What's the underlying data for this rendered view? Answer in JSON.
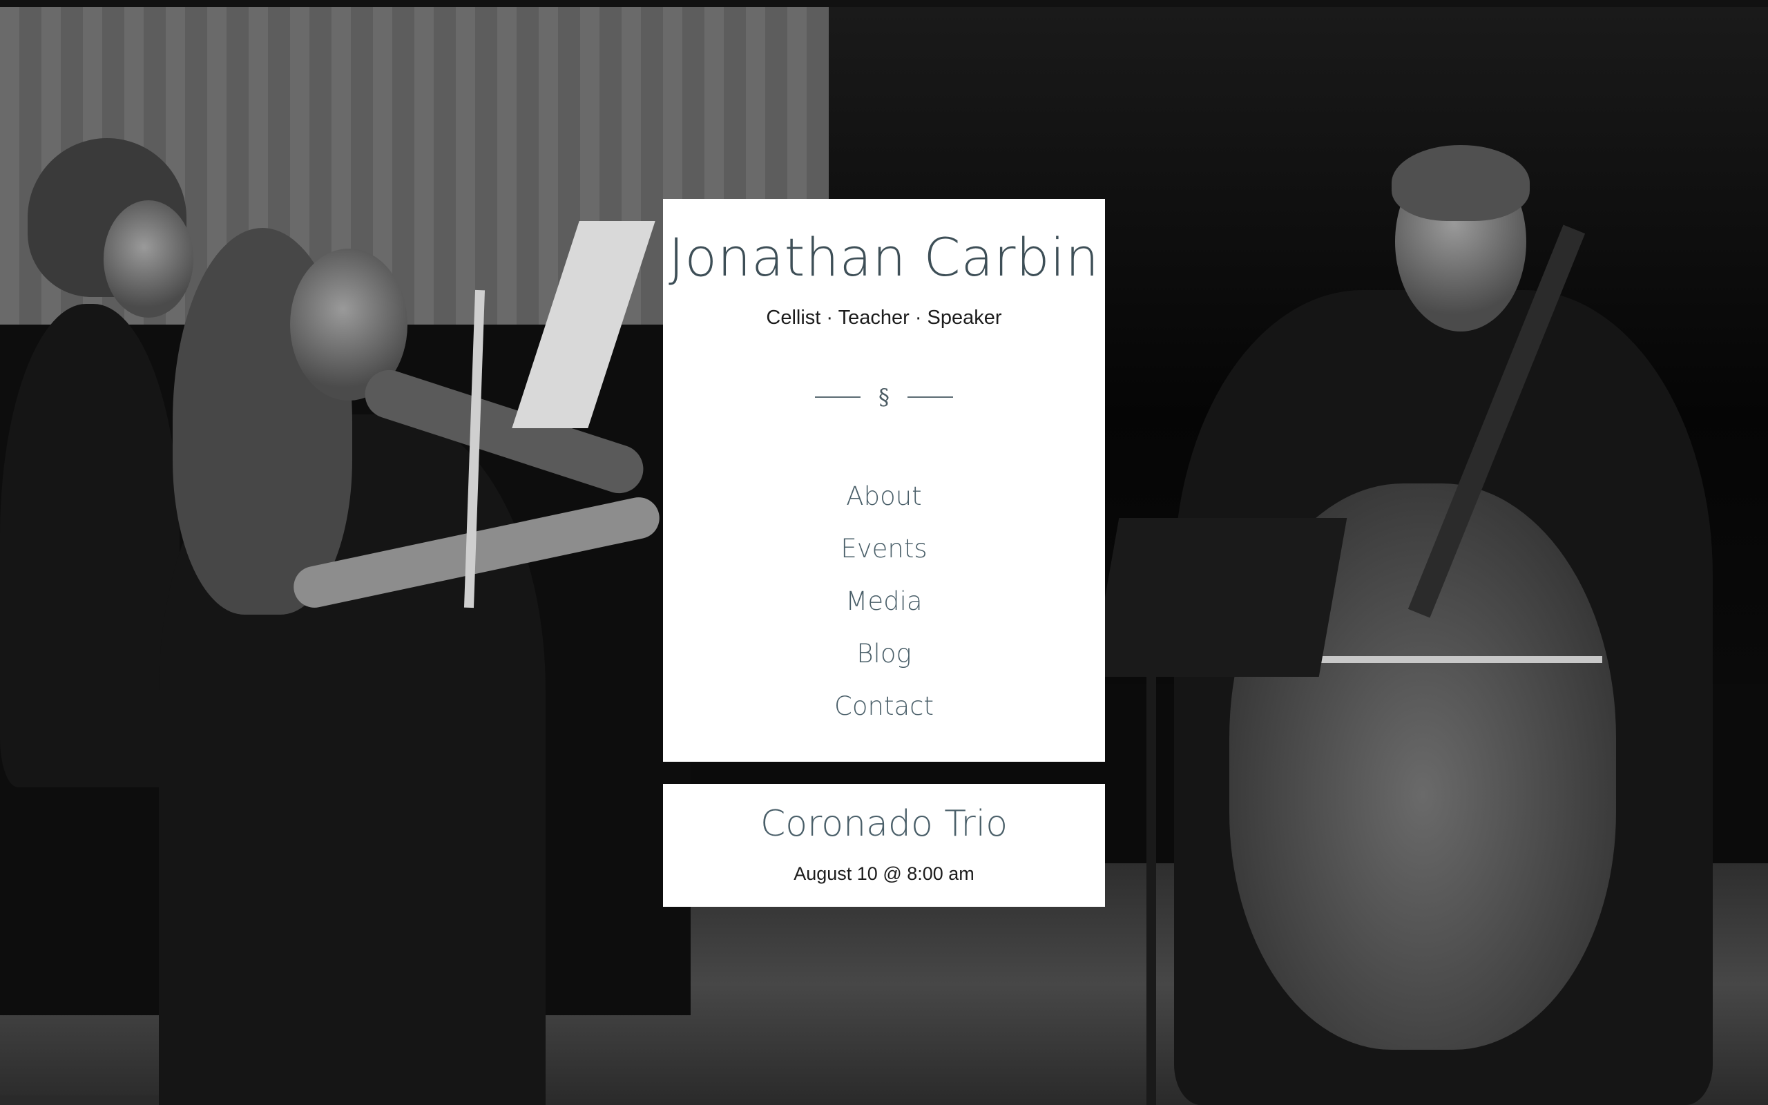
{
  "site": {
    "title": "Jonathan Carbin",
    "tagline": "Cellist · Teacher · Speaker",
    "divider_glyph": "§"
  },
  "nav": {
    "items": [
      {
        "label": "About"
      },
      {
        "label": "Events"
      },
      {
        "label": "Media"
      },
      {
        "label": "Blog"
      },
      {
        "label": "Contact"
      }
    ]
  },
  "upcoming_event": {
    "title": "Coronado Trio",
    "date": "August 10 @ 8:00 am"
  },
  "colors": {
    "accent": "#4a5f69",
    "card_background": "#ffffff",
    "text": "#1c1c1c"
  }
}
